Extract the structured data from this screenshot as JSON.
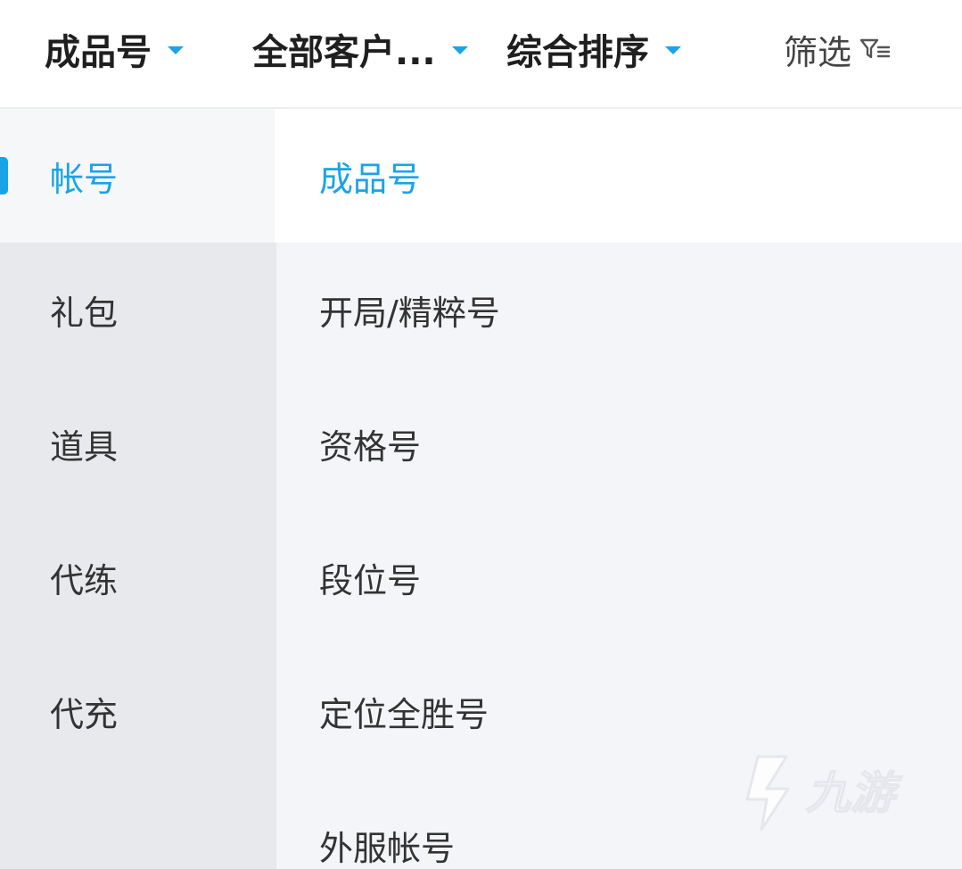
{
  "topbar": {
    "filters": [
      {
        "label": "成品号"
      },
      {
        "label": "全部客户..."
      },
      {
        "label": "综合排序"
      }
    ],
    "screen_label": "筛选"
  },
  "sidebar": {
    "items": [
      {
        "label": "帐号",
        "active": true
      },
      {
        "label": "礼包"
      },
      {
        "label": "道具"
      },
      {
        "label": "代练"
      },
      {
        "label": "代充"
      }
    ]
  },
  "content": {
    "items": [
      {
        "label": "成品号",
        "active": true
      },
      {
        "label": "开局/精粹号"
      },
      {
        "label": "资格号"
      },
      {
        "label": "段位号"
      },
      {
        "label": "定位全胜号"
      },
      {
        "label": "外服帐号"
      }
    ]
  },
  "watermark": {
    "text": "九游"
  },
  "colors": {
    "accent": "#1aa3e8",
    "text_primary": "#1f1f1f",
    "text_secondary": "#333333",
    "sidebar_bg": "#e7e9ec",
    "content_bg": "#f4f5f8"
  },
  "icons": {
    "caret": "caret-down-icon",
    "filter": "filter-funnel-icon",
    "watermark": "jiuyou-logo-icon"
  }
}
